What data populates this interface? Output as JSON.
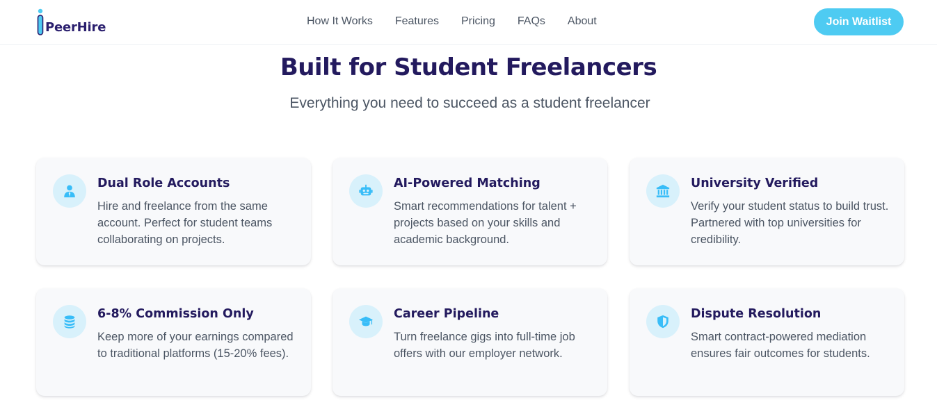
{
  "header": {
    "logo_text": "PeerHire",
    "nav": [
      "How It Works",
      "Features",
      "Pricing",
      "FAQs",
      "About"
    ],
    "cta_label": "Join Waitlist"
  },
  "section": {
    "title": "Built for Student Freelancers",
    "subtitle": "Everything you need to succeed as a student freelancer"
  },
  "features": [
    {
      "icon": "user-tie-icon",
      "title": "Dual Role Accounts",
      "description": "Hire and freelance from the same account. Perfect for student teams collaborating on projects."
    },
    {
      "icon": "robot-icon",
      "title": "AI-Powered Matching",
      "description": "Smart recommendations for talent + projects based on your skills and academic background."
    },
    {
      "icon": "university-icon",
      "title": "University Verified",
      "description": "Verify your student status to build trust. Partnered with top universities for credibility."
    },
    {
      "icon": "coins-icon",
      "title": "6-8% Commission Only",
      "description": "Keep more of your earnings compared to traditional platforms (15-20% fees)."
    },
    {
      "icon": "graduation-cap-icon",
      "title": "Career Pipeline",
      "description": "Turn freelance gigs into full-time job offers with our employer network."
    },
    {
      "icon": "shield-icon",
      "title": "Dispute Resolution",
      "description": "Smart contract-powered mediation ensures fair outcomes for students."
    }
  ],
  "colors": {
    "accent": "#4ecbf2",
    "heading": "#231a5e",
    "body_text": "#4b5563",
    "card_bg": "#f8f9fb",
    "icon_bg": "#d8f1fb"
  }
}
